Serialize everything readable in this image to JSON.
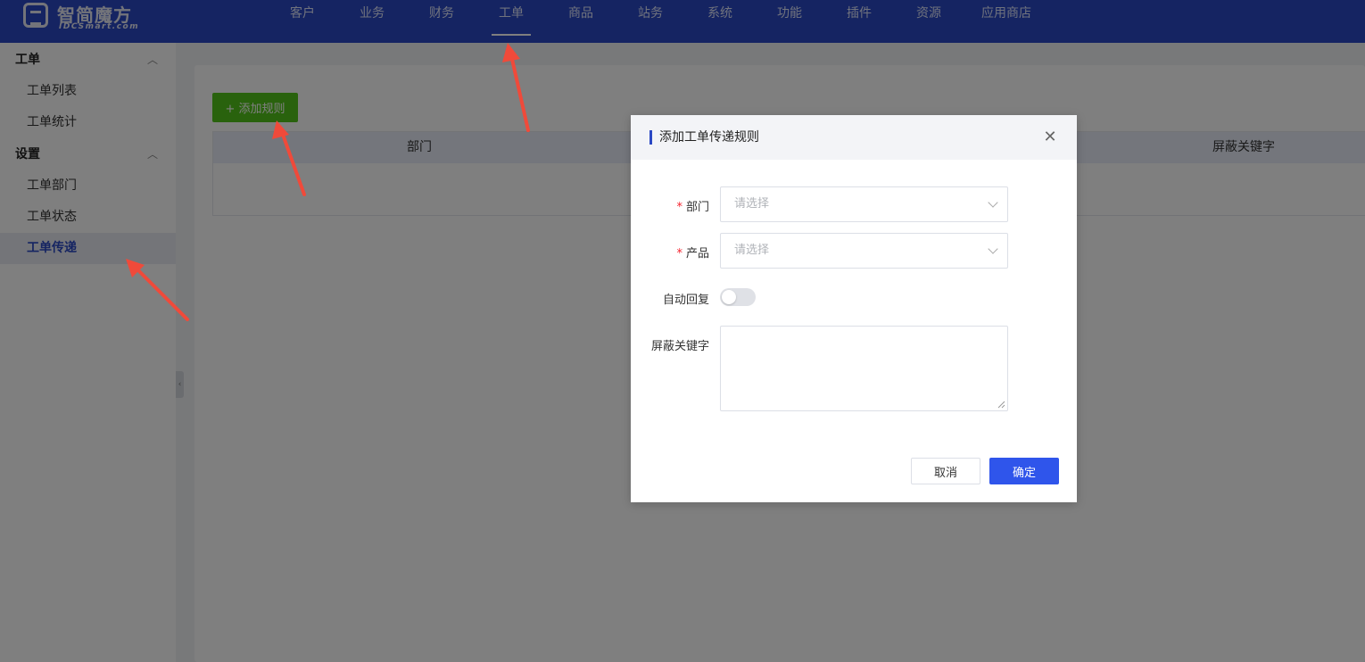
{
  "brand": {
    "name": "智简魔方",
    "sub": "IDCSmart.com"
  },
  "nav": [
    {
      "label": "客户"
    },
    {
      "label": "业务"
    },
    {
      "label": "财务"
    },
    {
      "label": "工单"
    },
    {
      "label": "商品"
    },
    {
      "label": "站务"
    },
    {
      "label": "系统"
    },
    {
      "label": "功能"
    },
    {
      "label": "插件"
    },
    {
      "label": "资源"
    },
    {
      "label": "应用商店"
    }
  ],
  "nav_active": "工单",
  "sidebar": {
    "groups": [
      {
        "label": "工单",
        "items": [
          {
            "label": "工单列表"
          },
          {
            "label": "工单统计"
          }
        ]
      },
      {
        "label": "设置",
        "items": [
          {
            "label": "工单部门"
          },
          {
            "label": "工单状态"
          },
          {
            "label": "工单传递"
          }
        ]
      }
    ],
    "active_item": "工单传递"
  },
  "main": {
    "add_button": "+ 添加规则",
    "table_headers": [
      "部门",
      "屏蔽关键字"
    ]
  },
  "dialog": {
    "title": "添加工单传递规则",
    "fields": {
      "department": {
        "label": "部门",
        "placeholder": "请选择",
        "required": true
      },
      "product": {
        "label": "产品",
        "placeholder": "请选择",
        "required": true
      },
      "auto_reply": {
        "label": "自动回复",
        "checked": false
      },
      "keywords": {
        "label": "屏蔽关键字",
        "value": ""
      }
    },
    "cancel": "取消",
    "confirm": "确定"
  },
  "colors": {
    "nav_bg": "#2b48c4",
    "add_button": "#52c41a",
    "primary": "#2f55eb",
    "annotation_arrow": "#f04a3a"
  }
}
